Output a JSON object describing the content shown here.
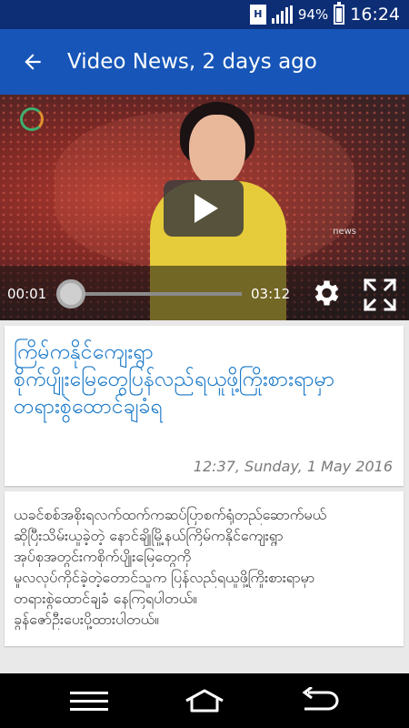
{
  "status_bar": {
    "network_badge": "H",
    "battery": "94%",
    "time": "16:24",
    "battery_level": 0.94,
    "icons": [
      "network-type-icon",
      "signal-icon",
      "battery-icon"
    ]
  },
  "app_bar": {
    "title": "Video News, 2 days ago",
    "back_icon": "arrow-left-icon",
    "color": "#1756b8"
  },
  "player": {
    "current_time": "00:01",
    "duration": "03:12",
    "progress": 0.005,
    "overlay_text": "news",
    "icons": [
      "play-icon",
      "settings-gear-icon",
      "fullscreen-icon"
    ]
  },
  "article": {
    "headline": "ကြိမ်ကနိုင်ကျေးရွာ စိုက်ပျိုးမြေတွေပြန်လည်ရယူဖို့ကြိုးစားရာမှာ တရားစွဲထောင်ချခံရ",
    "headline_lines": [
      "ကြိမ်ကနိုင်ကျေးရွာ",
      "စိုက်ပျိုးမြေတွေပြန်လည်ရယူဖို့ကြိုးစားရာမှာ",
      "တရားစွဲထောင်ချခံရ"
    ],
    "headline_color": "#1a79c9",
    "date": "12:37, Sunday, 1 May 2016",
    "body_lines": [
      "ယခင်စစ်အစိုးရလက်ထက်ကဆပ်ပြာစက်ရုံတည်ဆောက်မယ်",
      "ဆိုပြီးသိမ်းယူခဲ့တဲ့ နောင်ချိုမြို့နယ်ကြိမ်ကနိုင်ကျေးရွာ",
      "အုပ်စုအတွင်းကစိုက်ပျိုးမြေတွေကို",
      "မူလလုပ်ကိုင်ခဲ့တဲ့တောင်သူက ပြန်လည်ရယူဖို့ကြိုးစားရာမှာ",
      "တရားစွဲထောင်ချခံ နေကြရပါတယ်။",
      "ခွန်ဇော်ဦးပေးပို့ထားပါတယ်။"
    ]
  },
  "nav_bar": {
    "icons": [
      "menu-icon",
      "home-icon",
      "back-icon"
    ]
  }
}
